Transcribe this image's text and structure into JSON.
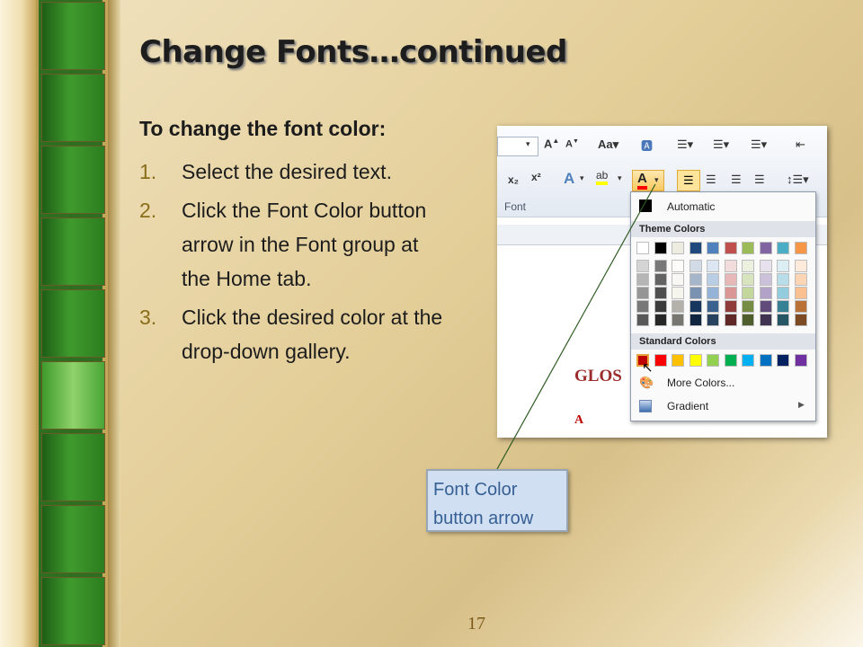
{
  "title": "Change Fonts…continued",
  "lead": "To change the font color:",
  "steps": [
    {
      "num": "1.",
      "text": "Select the desired text."
    },
    {
      "num": "2.",
      "text": "Click the Font Color button arrow in the Font group at the Home tab."
    },
    {
      "num": "3.",
      "text": "Click the desired color at the drop-down gallery."
    }
  ],
  "screenshot": {
    "group_label": "Font",
    "gallery": {
      "automatic": "Automatic",
      "theme_colors": "Theme Colors",
      "standard_colors": "Standard Colors",
      "more_colors": "More Colors...",
      "gradient": "Gradient"
    },
    "doc_text": "GLOS",
    "doc_letter": "A",
    "theme_top_row": [
      "#ffffff",
      "#000000",
      "#eeece1",
      "#1f497d",
      "#4f81bd",
      "#c0504d",
      "#9bbb59",
      "#8064a2",
      "#4bacc6",
      "#f79646"
    ],
    "standard_row": [
      "#c00000",
      "#ff0000",
      "#ffc000",
      "#ffff00",
      "#92d050",
      "#00b050",
      "#00b0f0",
      "#0070c0",
      "#002060",
      "#7030a0"
    ]
  },
  "callout": {
    "line1": "Font Color",
    "line2": "button arrow"
  },
  "page_number": "17"
}
